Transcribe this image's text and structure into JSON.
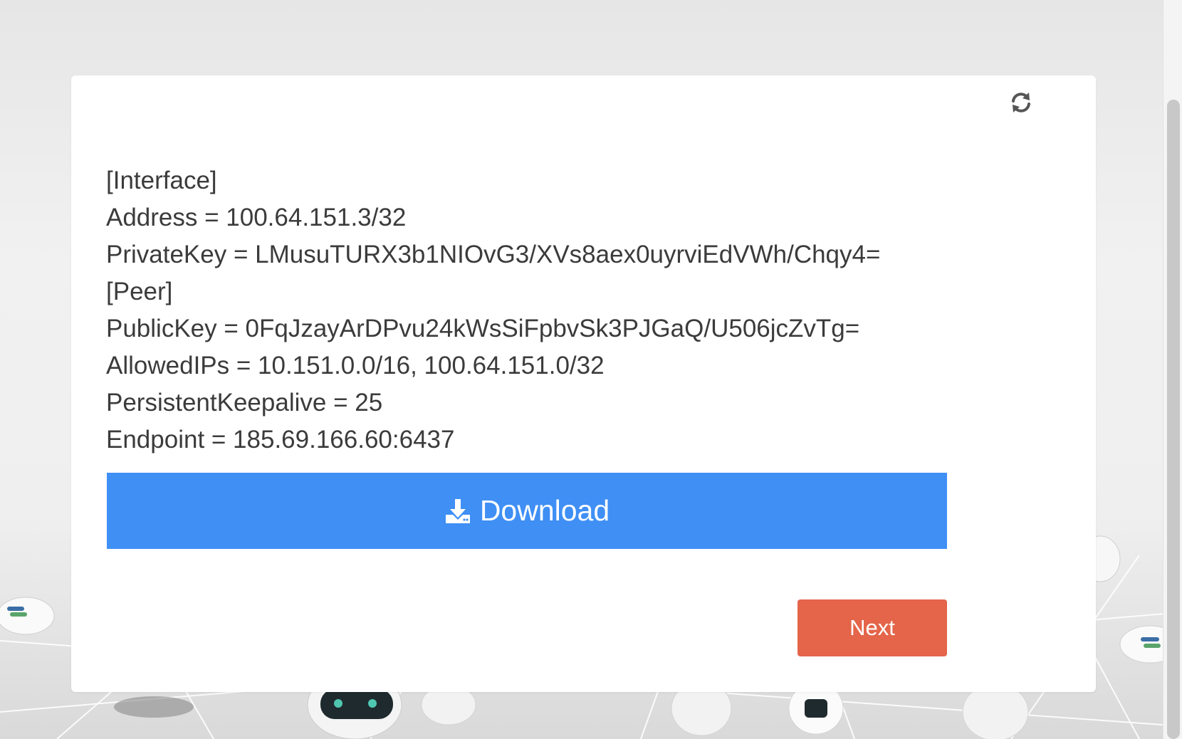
{
  "colors": {
    "download_button": "#3f8ff5",
    "next_button": "#e4654a",
    "text": "#3b3b3b",
    "card_background": "#ffffff"
  },
  "toolbar": {
    "refresh_icon": "refresh-icon"
  },
  "config": {
    "lines": [
      "[Interface]",
      "Address = 100.64.151.3/32",
      "PrivateKey = LMusuTURX3b1NIOvG3/XVs8aex0uyrviEdVWh/Chqy4=",
      "[Peer]",
      "PublicKey = 0FqJzayArDPvu24kWsSiFpbvSk3PJGaQ/U506jcZvTg=",
      "AllowedIPs = 10.151.0.0/16, 100.64.151.0/32",
      "PersistentKeepalive = 25",
      "Endpoint = 185.69.166.60:6437"
    ]
  },
  "actions": {
    "download_label": "Download",
    "download_icon": "download-icon",
    "next_label": "Next"
  }
}
